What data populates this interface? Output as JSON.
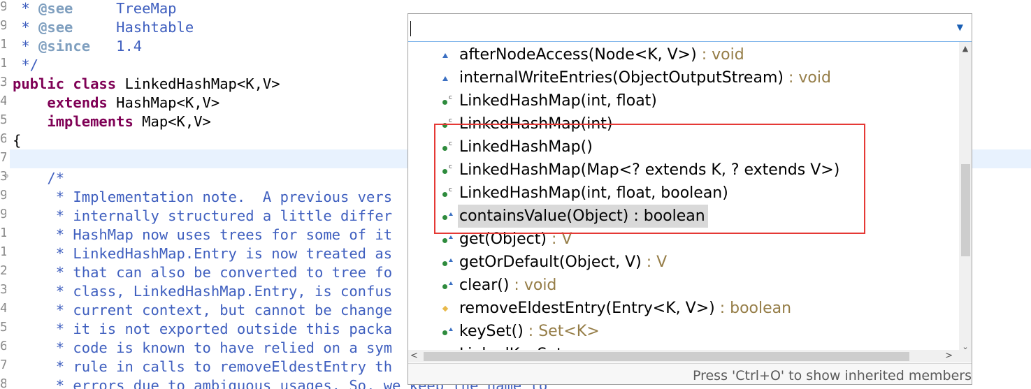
{
  "editor": {
    "gutter": [
      "9",
      "9",
      "1",
      "1",
      "3",
      "4",
      "5",
      "6",
      "7",
      "3",
      "9",
      "9",
      "1",
      "1",
      "2",
      "3",
      "4",
      "5",
      "6",
      "7",
      "8"
    ],
    "lines": [
      {
        "indent": " * ",
        "tag": "@see",
        "tagtext": "     TreeMap"
      },
      {
        "indent": " * ",
        "tag": "@see",
        "tagtext": "     Hashtable"
      },
      {
        "indent": " * ",
        "tag": "@since",
        "tagtext": "   1.4"
      },
      {
        "plain": " */"
      },
      {
        "kw": "public class ",
        "code": "LinkedHashMap<K,V>"
      },
      {
        "kw": "    extends ",
        "code": "HashMap<K,V>"
      },
      {
        "kw": "    implements ",
        "code": "Map<K,V>"
      },
      {
        "code": "{"
      },
      {
        "code": ""
      },
      {
        "jdoc": "    /*"
      },
      {
        "jdoc": "     * Implementation note.  A previous vers"
      },
      {
        "jdoc": "     * internally structured a little differ"
      },
      {
        "jdoc": "     * HashMap now uses trees for some of it"
      },
      {
        "jdoc": "     * LinkedHashMap.Entry is now treated as"
      },
      {
        "jdoc": "     * that can also be converted to tree fo"
      },
      {
        "jdoc": "     * class, LinkedHashMap.Entry, is confus"
      },
      {
        "jdoc": "     * current context, but cannot be change"
      },
      {
        "jdoc": "     * it is not exported outside this packa"
      },
      {
        "jdoc": "     * code is known to have relied on a sym"
      },
      {
        "jdoc": "     * rule in calls to removeEldestEntry th"
      },
      {
        "jdoc": "     * errors due to ambiguous usages. So, we keep the name to"
      }
    ]
  },
  "outline": {
    "filter": {
      "value": "",
      "placeholder": ""
    },
    "items": [
      {
        "name": "afterNodeAccess(Node<K, V>)",
        "ret": " : void",
        "icon": "tri",
        "overlay": "none"
      },
      {
        "name": "internalWriteEntries(ObjectOutputStream)",
        "ret": " : void",
        "icon": "tri",
        "overlay": "none"
      },
      {
        "name": "LinkedHashMap(int, float)",
        "ret": "",
        "icon": "green",
        "overlay": "c"
      },
      {
        "name": "LinkedHashMap(int)",
        "ret": "",
        "icon": "green",
        "overlay": "c"
      },
      {
        "name": "LinkedHashMap()",
        "ret": "",
        "icon": "green",
        "overlay": "c"
      },
      {
        "name": "LinkedHashMap(Map<? extends K, ? extends V>)",
        "ret": "",
        "icon": "green",
        "overlay": "c"
      },
      {
        "name": "LinkedHashMap(int, float, boolean)",
        "ret": "",
        "icon": "green",
        "overlay": "c"
      },
      {
        "name": "containsValue(Object) : boolean",
        "ret": "",
        "icon": "green",
        "overlay": "tri",
        "selected": true
      },
      {
        "name": "get(Object)",
        "ret": " : V",
        "icon": "green",
        "overlay": "tri"
      },
      {
        "name": "getOrDefault(Object, V)",
        "ret": " : V",
        "icon": "green",
        "overlay": "tri"
      },
      {
        "name": "clear()",
        "ret": " : void",
        "icon": "green",
        "overlay": "tri"
      },
      {
        "name": "removeEldestEntry(Entry<K, V>)",
        "ret": " : boolean",
        "icon": "diamond",
        "overlay": "none"
      },
      {
        "name": "keySet()",
        "ret": " : Set<K>",
        "icon": "green",
        "overlay": "tri"
      },
      {
        "name": "LinkedKeySet",
        "ret": "",
        "icon": "green",
        "overlay": "none"
      }
    ],
    "status": "Press 'Ctrl+O' to show inherited members"
  },
  "colors": {
    "highlight": "#e53935",
    "return_type": "#957d47",
    "keyword": "#7f0055",
    "javadoc": "#3f5fbf"
  }
}
